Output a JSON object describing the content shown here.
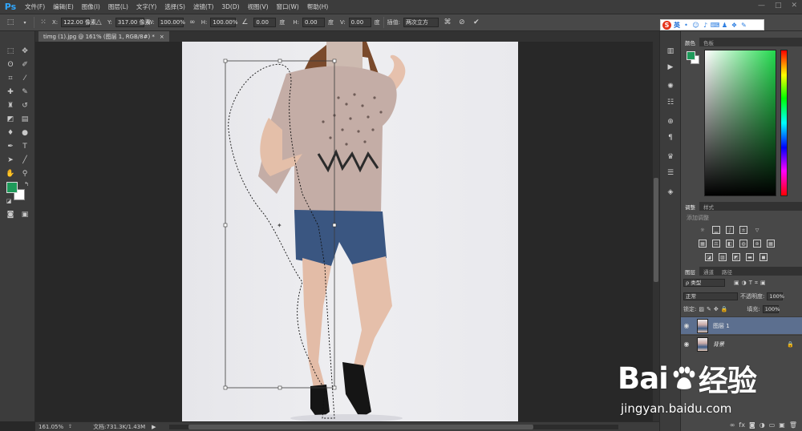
{
  "app": {
    "logo": "Ps"
  },
  "menu": [
    "文件(F)",
    "编辑(E)",
    "图像(I)",
    "图层(L)",
    "文字(Y)",
    "选择(S)",
    "滤镜(T)",
    "3D(D)",
    "视图(V)",
    "窗口(W)",
    "帮助(H)"
  ],
  "window_controls": [
    "—",
    "□",
    "✕"
  ],
  "options": {
    "x_label": "X:",
    "x_value": "122.00 像素",
    "y_label": "Y:",
    "y_value": "317.00 像素",
    "w_label": "W:",
    "w_value": "100.00%",
    "h_label": "H:",
    "h_value": "100.00%",
    "angle_value": "0.00",
    "angle_unit": "度",
    "hskew_label": "H:",
    "hskew_value": "0.00",
    "hskew_unit": "度",
    "vskew_label": "V:",
    "vskew_value": "0.00",
    "vskew_unit": "度",
    "interp_label": "插值:",
    "interp_value": "两次立方"
  },
  "sogou": {
    "lang": "英"
  },
  "document": {
    "tab_title": "timg (1).jpg @ 161% (图层 1, RGB/8#) *",
    "close": "×"
  },
  "status": {
    "zoom": "161.05%",
    "doc_size": "文档:731.3K/1.43M",
    "arrow": "▶"
  },
  "panels": {
    "color_tabs": [
      "颜色",
      "色板"
    ],
    "adjust_tabs": [
      "调整",
      "样式"
    ],
    "adjust_title": "添加调整",
    "layers_tabs": [
      "图层",
      "通道",
      "路径"
    ],
    "filter_kind": "ρ 类型",
    "blend_mode": "正常",
    "opacity_label": "不透明度:",
    "opacity_value": "100%",
    "lock_label": "锁定:",
    "fill_label": "填充:",
    "fill_value": "100%",
    "layers": [
      {
        "name": "图层 1",
        "selected": true
      },
      {
        "name": "背景",
        "selected": false
      }
    ]
  },
  "watermark": {
    "brand": "Bai",
    "brand2": "经验",
    "url": "jingyan.baidu.com"
  },
  "colors": {
    "foreground": "#1e9a5a",
    "background": "#ffffff",
    "accent": "#31a8ff",
    "selection": "#5c6f8f"
  }
}
